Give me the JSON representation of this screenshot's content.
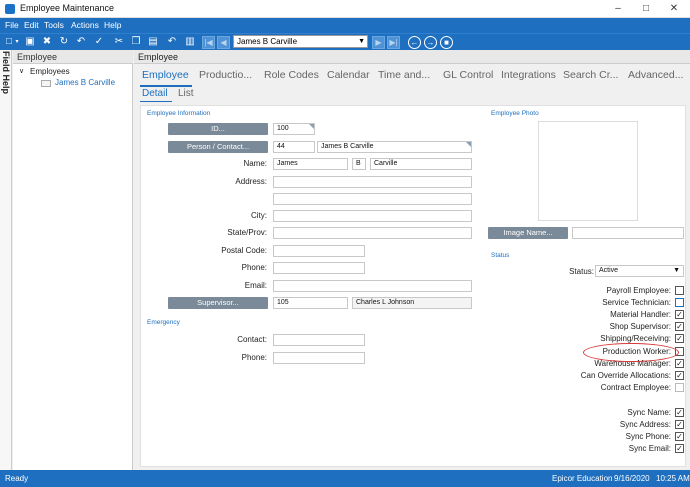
{
  "window": {
    "title": "Employee Maintenance"
  },
  "menu": [
    "File",
    "Edit",
    "Tools",
    "Actions",
    "Help"
  ],
  "toolbar": {
    "nav_value": "James B Carville"
  },
  "side": {
    "field_help": "Field Help"
  },
  "tree": {
    "header": "Employee",
    "root": "Employees",
    "child": "James B Carville"
  },
  "main": {
    "header": "Employee"
  },
  "tabs": [
    "Employee",
    "Productio...",
    "Role Codes",
    "Calendar",
    "Time and...",
    "GL Control",
    "Integrations",
    "Search Cr...",
    "Advanced..."
  ],
  "subtabs": [
    "Detail",
    "List"
  ],
  "form": {
    "section_info": "Employee Information",
    "id_btn": "ID...",
    "id_val": "100",
    "person_btn": "Person / Contact...",
    "person_id": "44",
    "person_name": "James B Carville",
    "name_lbl": "Name:",
    "first": "James",
    "middle": "B",
    "last": "Carville",
    "address_lbl": "Address:",
    "city_lbl": "City:",
    "state_lbl": "State/Prov:",
    "postal_lbl": "Postal Code:",
    "phone_lbl": "Phone:",
    "email_lbl": "Email:",
    "supervisor_btn": "Supervisor...",
    "supervisor_id": "105",
    "supervisor_name": "Charles L Johnson",
    "section_emergency": "Emergency",
    "contact_lbl": "Contact:",
    "ephone_lbl": "Phone:"
  },
  "photo": {
    "section": "Employee Photo",
    "image_btn": "Image Name..."
  },
  "status": {
    "section": "Status",
    "status_lbl": "Status:",
    "status_val": "Active",
    "checks": [
      {
        "label": "Payroll Employee:",
        "checked": false
      },
      {
        "label": "Service Technician:",
        "checked": false
      },
      {
        "label": "Material Handler:",
        "checked": true
      },
      {
        "label": "Shop Supervisor:",
        "checked": true
      },
      {
        "label": "Shipping/Receiving:",
        "checked": true
      },
      {
        "label": "Production Worker:",
        "checked": false
      },
      {
        "label": "Warehouse Manager:",
        "checked": true
      },
      {
        "label": "Can Override Allocations:",
        "checked": true
      },
      {
        "label": "Contract Employee:",
        "checked": false
      }
    ],
    "sync": [
      {
        "label": "Sync Name:",
        "checked": true
      },
      {
        "label": "Sync Address:",
        "checked": true
      },
      {
        "label": "Sync Phone:",
        "checked": true
      },
      {
        "label": "Sync Email:",
        "checked": true
      }
    ]
  },
  "statusbar": {
    "left": "Ready",
    "company": "Epicor Education",
    "date": "9/16/2020",
    "time": "10:25 AM"
  },
  "colors": {
    "accent": "#1e6fbf",
    "annotation": "#d63a3a"
  }
}
